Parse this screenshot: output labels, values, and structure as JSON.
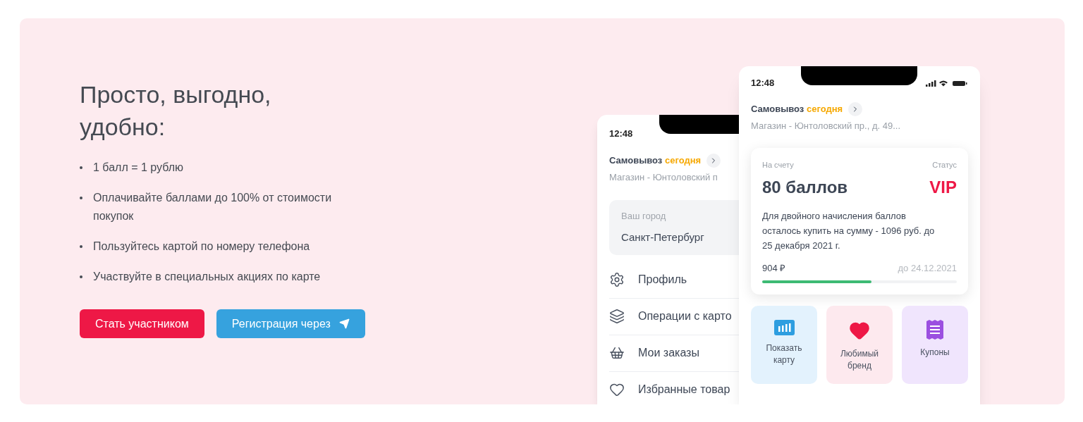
{
  "heading": "Просто, выгодно, удобно:",
  "benefits": [
    "1 балл = 1 рублю",
    "Оплачивайте баллами до 100% от стоимости покупок",
    "Пользуйтесь картой по номеру телефона",
    "Участвуйте в специальных акциях по карте"
  ],
  "buttons": [
    {
      "label": "Стать участником",
      "kind": "primary"
    },
    {
      "label": "Регистрация через",
      "kind": "telegram"
    }
  ],
  "back_phone": {
    "time": "12:48",
    "pickup": {
      "label": "Самовывоз",
      "day": "сегодня"
    },
    "store": "Магазин - Юнтоловский п",
    "city": {
      "label": "Ваш город",
      "value": "Санкт-Петербург"
    },
    "menu": [
      {
        "label": "Профиль",
        "kind": "gear"
      },
      {
        "label": "Операции с карто",
        "kind": "cards"
      },
      {
        "label": "Мои заказы",
        "kind": "basket"
      },
      {
        "label": "Избранные товар",
        "kind": "heart"
      }
    ]
  },
  "front_phone": {
    "time": "12:48",
    "pickup": {
      "label": "Самовывоз",
      "day": "сегодня"
    },
    "store": "Магазин - Юнтоловский пр., д. 49...",
    "account": {
      "balance_label": "На счету",
      "balance": "80 баллов",
      "status_label": "Статус",
      "status": "VIP",
      "note": "Для двойного начисления баллов осталось купить на сумму - 1096 руб. до 25 декабря 2021 г.",
      "amount": "904 ₽",
      "deadline": "до 24.12.2021",
      "level": 0.56
    },
    "tiles": [
      {
        "label": "Показать карту",
        "kind": "card"
      },
      {
        "label": "Любимый бренд",
        "kind": "brand"
      },
      {
        "label": "Купоны",
        "kind": "coupons"
      }
    ]
  }
}
